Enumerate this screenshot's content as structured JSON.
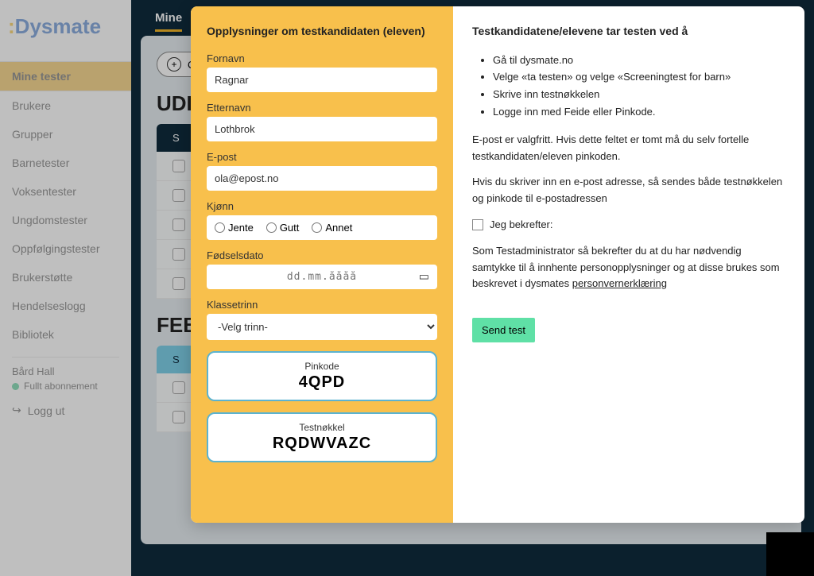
{
  "brand": {
    "colon": ":",
    "dy": "Dy",
    "smate": "smate"
  },
  "sidebar": {
    "items": [
      "Mine tester",
      "Brukere",
      "Grupper",
      "Barnetester",
      "Voksentester",
      "Ungdomstester",
      "Oppfølgingstester",
      "Brukerstøtte",
      "Hendelseslogg",
      "Bibliotek"
    ],
    "user": "Bård Hall",
    "subscription": "Fullt abonnement",
    "logout": "Logg ut"
  },
  "main": {
    "tab": "Mine",
    "pill": "O",
    "section1": "UDI",
    "section2": "FEB",
    "col": "S"
  },
  "modal": {
    "left": {
      "title": "Opplysninger om testkandidaten (eleven)",
      "fornavn_label": "Fornavn",
      "fornavn": "Ragnar",
      "etternavn_label": "Etternavn",
      "etternavn": "Lothbrok",
      "epost_label": "E-post",
      "epost": "ola@epost.no",
      "kjonn_label": "Kjønn",
      "kjonn": {
        "jente": "Jente",
        "gutt": "Gutt",
        "annet": "Annet"
      },
      "dato_label": "Fødselsdato",
      "dato_placeholder": "dd.mm.åååå",
      "klasse_label": "Klassetrinn",
      "klasse_placeholder": "-Velg trinn-",
      "pin_label": "Pinkode",
      "pin": "4QPD",
      "key_label": "Testnøkkel",
      "key": "RQDWVAZC"
    },
    "right": {
      "heading": "Testkandidatene/elevene tar testen ved å",
      "steps": [
        "Gå til dysmate.no",
        "Velge «ta testen» og velge «Screeningtest for barn»",
        "Skrive inn testnøkkelen",
        "Logge inn med Feide eller Pinkode."
      ],
      "p1": "E-post er valgfritt. Hvis dette feltet er tomt må du selv fortelle testkandidaten/eleven pinkoden.",
      "p2": "Hvis du skriver inn en e-post adresse, så sendes både testnøkkelen og pinkode til e-postadressen",
      "confirm": "Jeg bekrefter:",
      "p3a": "Som Testadministrator så bekrefter du at du har nødvendig samtykke til å innhente personopplysninger og at disse brukes som beskrevet i dysmates ",
      "p3b": "personvernerklæring",
      "send": "Send test"
    }
  }
}
